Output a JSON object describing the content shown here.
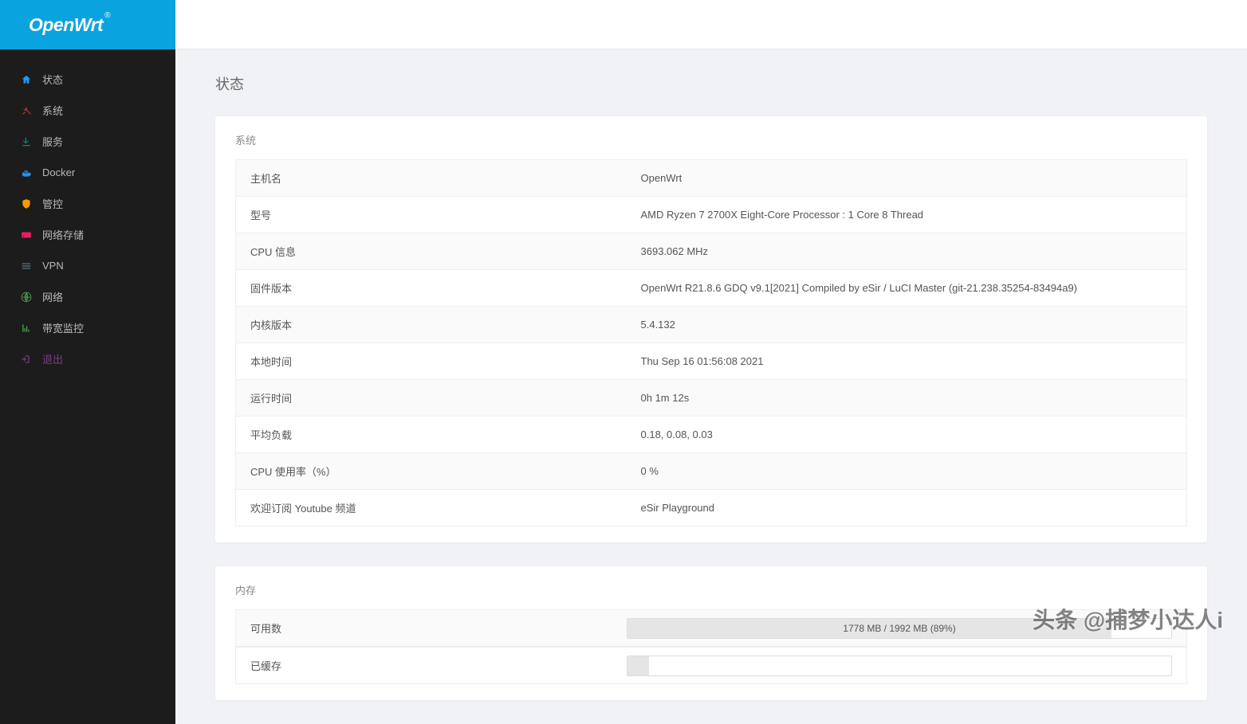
{
  "brand": "OpenWrt",
  "brand_suffix": "®",
  "sidebar": {
    "items": [
      {
        "label": "状态",
        "icon": "home-icon",
        "color": "#2196f3"
      },
      {
        "label": "系统",
        "icon": "tools-icon",
        "color": "#f44336"
      },
      {
        "label": "服务",
        "icon": "download-icon",
        "color": "#009688"
      },
      {
        "label": "Docker",
        "icon": "docker-icon",
        "color": "#2196f3"
      },
      {
        "label": "管控",
        "icon": "shield-icon",
        "color": "#ff9800"
      },
      {
        "label": "网络存储",
        "icon": "storage-icon",
        "color": "#e91e63"
      },
      {
        "label": "VPN",
        "icon": "list-icon",
        "color": "#607d8b"
      },
      {
        "label": "网络",
        "icon": "globe-icon",
        "color": "#4caf50"
      },
      {
        "label": "带宽监控",
        "icon": "chart-icon",
        "color": "#4caf50"
      },
      {
        "label": "退出",
        "icon": "logout-icon",
        "color": "#7a3d8c",
        "logout": true
      }
    ]
  },
  "page": {
    "title": "状态"
  },
  "system_panel": {
    "title": "系统",
    "rows": [
      {
        "label": "主机名",
        "value": "OpenWrt"
      },
      {
        "label": "型号",
        "value": "AMD Ryzen 7 2700X Eight-Core Processor : 1 Core 8 Thread"
      },
      {
        "label": "CPU 信息",
        "value": "3693.062 MHz"
      },
      {
        "label": "固件版本",
        "value": "OpenWrt R21.8.6 GDQ v9.1[2021] Compiled by eSir / LuCI Master (git-21.238.35254-83494a9)"
      },
      {
        "label": "内核版本",
        "value": "5.4.132"
      },
      {
        "label": "本地时间",
        "value": "Thu Sep 16 01:56:08 2021"
      },
      {
        "label": "运行时间",
        "value": "0h 1m 12s"
      },
      {
        "label": "平均负载",
        "value": "0.18, 0.08, 0.03"
      },
      {
        "label": "CPU 使用率（%）",
        "value": "0 %"
      },
      {
        "label": "欢迎订阅 Youtube 频道",
        "value": "eSir Playground"
      }
    ]
  },
  "memory_panel": {
    "title": "内存",
    "rows": [
      {
        "label": "可用数",
        "text": "1778 MB / 1992 MB (89%)",
        "percent": 89
      },
      {
        "label": "已缓存",
        "text": "",
        "percent": 4
      }
    ]
  },
  "watermark": "头条 @捕梦小达人i"
}
